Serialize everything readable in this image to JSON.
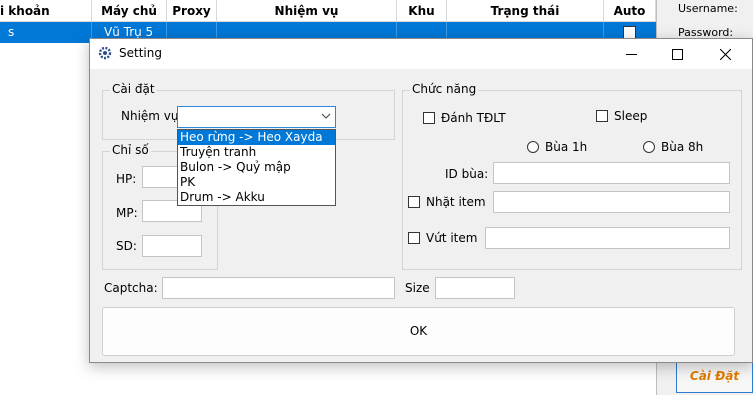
{
  "grid": {
    "columns": [
      "i khoản",
      "Máy chủ",
      "Proxy",
      "Nhiệm vụ",
      "Khu",
      "Trạng thái",
      "Auto"
    ],
    "row": {
      "account": "s",
      "server": "Vũ Trụ 5"
    }
  },
  "side_panel": {
    "username_label": "Username:",
    "password_label": "Password:",
    "caidat_button": "Cài Đặt"
  },
  "dialog": {
    "title": "Setting",
    "group_caidat": "Cài đặt",
    "nhiemvu_label": "Nhiệm vụ",
    "nhiemvu_value": "",
    "nhiemvu_options": [
      "Heo rừng -> Heo Xayda",
      "Truyện tranh",
      "Bulon -> Quỷ mập",
      "PK",
      "Drum -> Akku"
    ],
    "group_chiso": "Chỉ số",
    "hp_label": "HP:",
    "mp_label": "MP:",
    "sd_label": "SD:",
    "group_chucnang": "Chức năng",
    "danh_tdlt_label": "Đánh TĐLT",
    "sleep_label": "Sleep",
    "bua1h_label": "Bùa 1h",
    "bua8h_label": "Bùa 8h",
    "idbua_label": "ID bùa:",
    "nhat_item_label": "Nhặt item",
    "vut_item_label": "Vứt item",
    "captcha_label": "Captcha:",
    "size_label": "Size",
    "ok_label": "OK"
  }
}
